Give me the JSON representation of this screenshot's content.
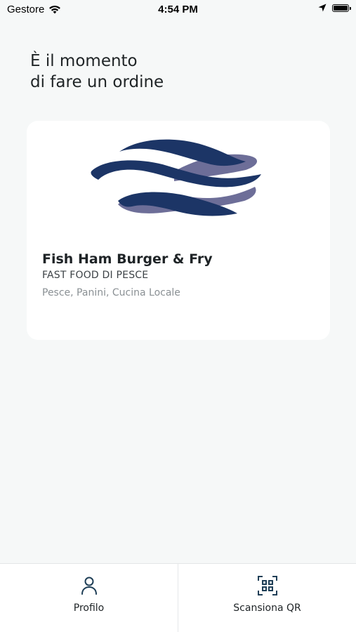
{
  "status_bar": {
    "carrier": "Gestore",
    "time": "4:54 PM"
  },
  "header": {
    "title_line1": "È il momento",
    "title_line2": "di fare un ordine"
  },
  "restaurant_card": {
    "name": "Fish Ham Burger & Fry",
    "category": "FAST FOOD DI PESCE",
    "tags": "Pesce, Panini, Cucina Locale",
    "logo_colors": {
      "primary": "#1c3566",
      "secondary": "#6d6e98"
    }
  },
  "tab_bar": {
    "tabs": [
      {
        "label": "Profilo",
        "icon": "person-icon"
      },
      {
        "label": "Scansiona QR",
        "icon": "qr-scan-icon"
      }
    ],
    "icon_color": "#1f3f57"
  }
}
